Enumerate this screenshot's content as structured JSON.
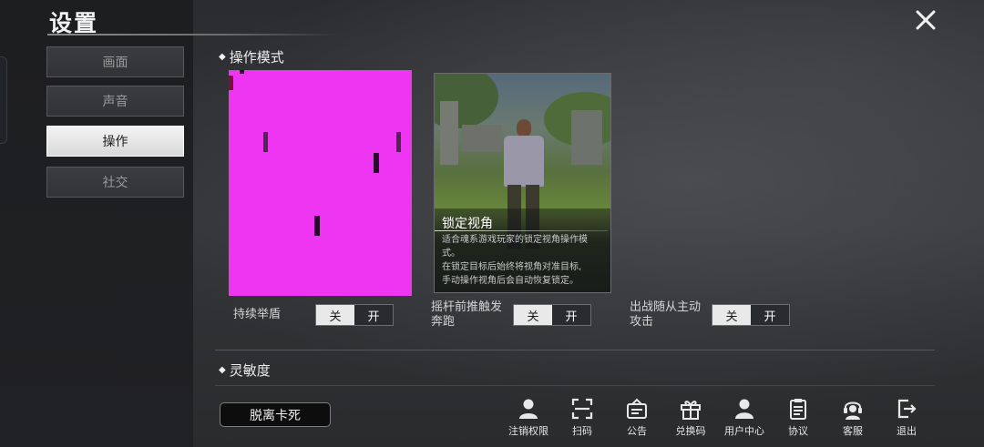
{
  "page": {
    "title": "设置",
    "accent_preview_color": "#ED35F2"
  },
  "sidebar": {
    "items": [
      {
        "label": "画面",
        "active": false
      },
      {
        "label": "声音",
        "active": false
      },
      {
        "label": "操作",
        "active": true
      },
      {
        "label": "社交",
        "active": false
      }
    ]
  },
  "close": {
    "icon": "close-icon"
  },
  "operation_mode": {
    "header": "操作模式",
    "card": {
      "title": "锁定视角",
      "description_line1": "适合魂系游戏玩家的锁定视角操作模",
      "description_line2": "式。",
      "description_line3": "在锁定目标后始终将视角对准目标,",
      "description_line4": "手动操作视角后会自动恢复锁定。"
    }
  },
  "toggles": [
    {
      "label": "持续举盾",
      "off": "关",
      "on": "开",
      "selected": "off"
    },
    {
      "label_line1": "摇杆前推触发",
      "label_line2": "奔跑",
      "off": "关",
      "on": "开",
      "selected": "off"
    },
    {
      "label_line1": "出战随从主动",
      "label_line2": "攻击",
      "off": "关",
      "on": "开",
      "selected": "off"
    }
  ],
  "sensitivity": {
    "header": "灵敏度"
  },
  "bottom": {
    "exit_stuck": "脱离卡死",
    "items": [
      {
        "label": "注销权限",
        "icon": "user-cancel-icon"
      },
      {
        "label": "扫码",
        "icon": "scan-icon"
      },
      {
        "label": "公告",
        "icon": "announcement-icon"
      },
      {
        "label": "兑换码",
        "icon": "gift-icon"
      },
      {
        "label": "用户中心",
        "icon": "user-icon"
      },
      {
        "label": "协议",
        "icon": "clipboard-icon"
      },
      {
        "label": "客服",
        "icon": "headset-icon"
      },
      {
        "label": "退出",
        "icon": "exit-icon"
      }
    ]
  }
}
